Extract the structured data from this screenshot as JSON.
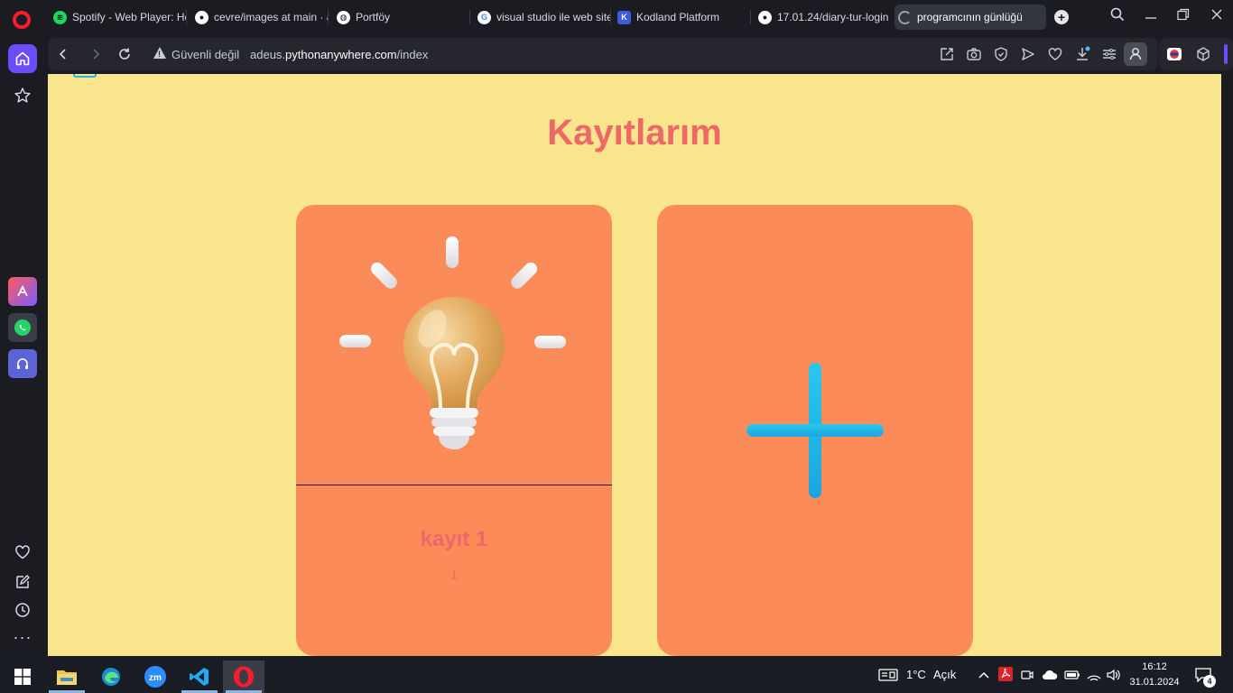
{
  "browser": {
    "tabs": [
      {
        "title": "Spotify - Web Player: He",
        "icon": "spotify-icon"
      },
      {
        "title": "cevre/images at main · a",
        "icon": "github-icon"
      },
      {
        "title": "Portföy",
        "icon": "globe-icon"
      },
      {
        "title": "visual studio ile web site",
        "icon": "google-icon"
      },
      {
        "title": "Kodland Platform",
        "icon": "kodland-icon"
      },
      {
        "title": "17.01.24/diary-tur-login",
        "icon": "github-icon"
      },
      {
        "title": "programcının günlüğü",
        "icon": "loading-icon",
        "active": true
      }
    ],
    "security_label": "Güvenli değil",
    "url_prefix": "adeus.",
    "url_domain": "pythonanywhere.com",
    "url_path": "/index"
  },
  "page": {
    "title": "Kayıtlarım",
    "cards": [
      {
        "type": "entry",
        "title": "kayıt 1",
        "subtitle": "1",
        "image": "lightbulb-icon"
      },
      {
        "type": "add",
        "icon": "plus-icon"
      }
    ],
    "colors": {
      "background": "#f8e58c",
      "card": "#fc8b5a",
      "title": "#f06767",
      "plus": "#22b8e8"
    }
  },
  "taskbar": {
    "apps": [
      "file-explorer-icon",
      "edge-icon",
      "zoom-icon",
      "vscode-icon",
      "opera-icon"
    ],
    "weather_temp": "1°C",
    "weather_desc": "Açık",
    "time": "16:12",
    "date": "31.01.2024",
    "notification_count": "4"
  }
}
